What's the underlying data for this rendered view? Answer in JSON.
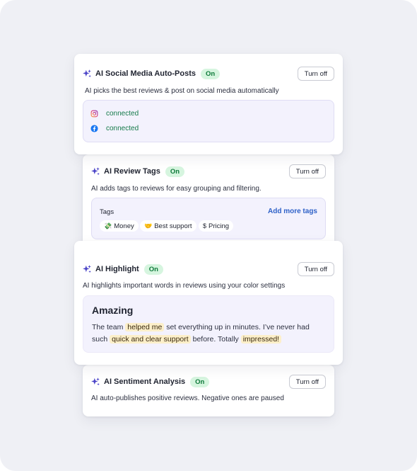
{
  "cards": {
    "social": {
      "title": "AI Social Media Auto-Posts",
      "status": "On",
      "button": "Turn off",
      "description": "AI picks the best reviews & post on social media automatically",
      "connections": [
        {
          "network": "instagram-icon",
          "status": "connected"
        },
        {
          "network": "facebook-icon",
          "status": "connected"
        }
      ]
    },
    "tags": {
      "title": "AI Review Tags",
      "status": "On",
      "button": "Turn off",
      "description": "AI adds tags to reviews for easy grouping and filtering.",
      "panel_label": "Tags",
      "add_label": "Add more tags",
      "chips": [
        {
          "emoji": "💸",
          "label": "Money"
        },
        {
          "emoji": "🤝",
          "label": "Best support"
        },
        {
          "emoji": "$",
          "label": "Pricing"
        }
      ]
    },
    "highlight": {
      "title": "AI Highlight",
      "status": "On",
      "button": "Turn off",
      "description": "AI highlights important words in reviews using your color settings",
      "review_title": "Amazing",
      "review": {
        "p1": "The team",
        "h1": "helped me",
        "p2": "set everything up in minutes. I’ve never had such",
        "h2": "quick and clear support",
        "p3": "before. Totally",
        "h3": "impressed!"
      }
    },
    "sentiment": {
      "title": "AI Sentiment Analysis",
      "status": "On",
      "button": "Turn off",
      "description": "AI auto-publishes positive reviews. Negative ones are paused"
    }
  },
  "colors": {
    "accent_purple": "#4b44c8",
    "on_badge_bg": "#d6f5df",
    "on_badge_text": "#0e7a3a",
    "link_blue": "#2f62c8",
    "highlight_bg": "#fcefc9",
    "panel_bg": "#f3f2fd"
  }
}
